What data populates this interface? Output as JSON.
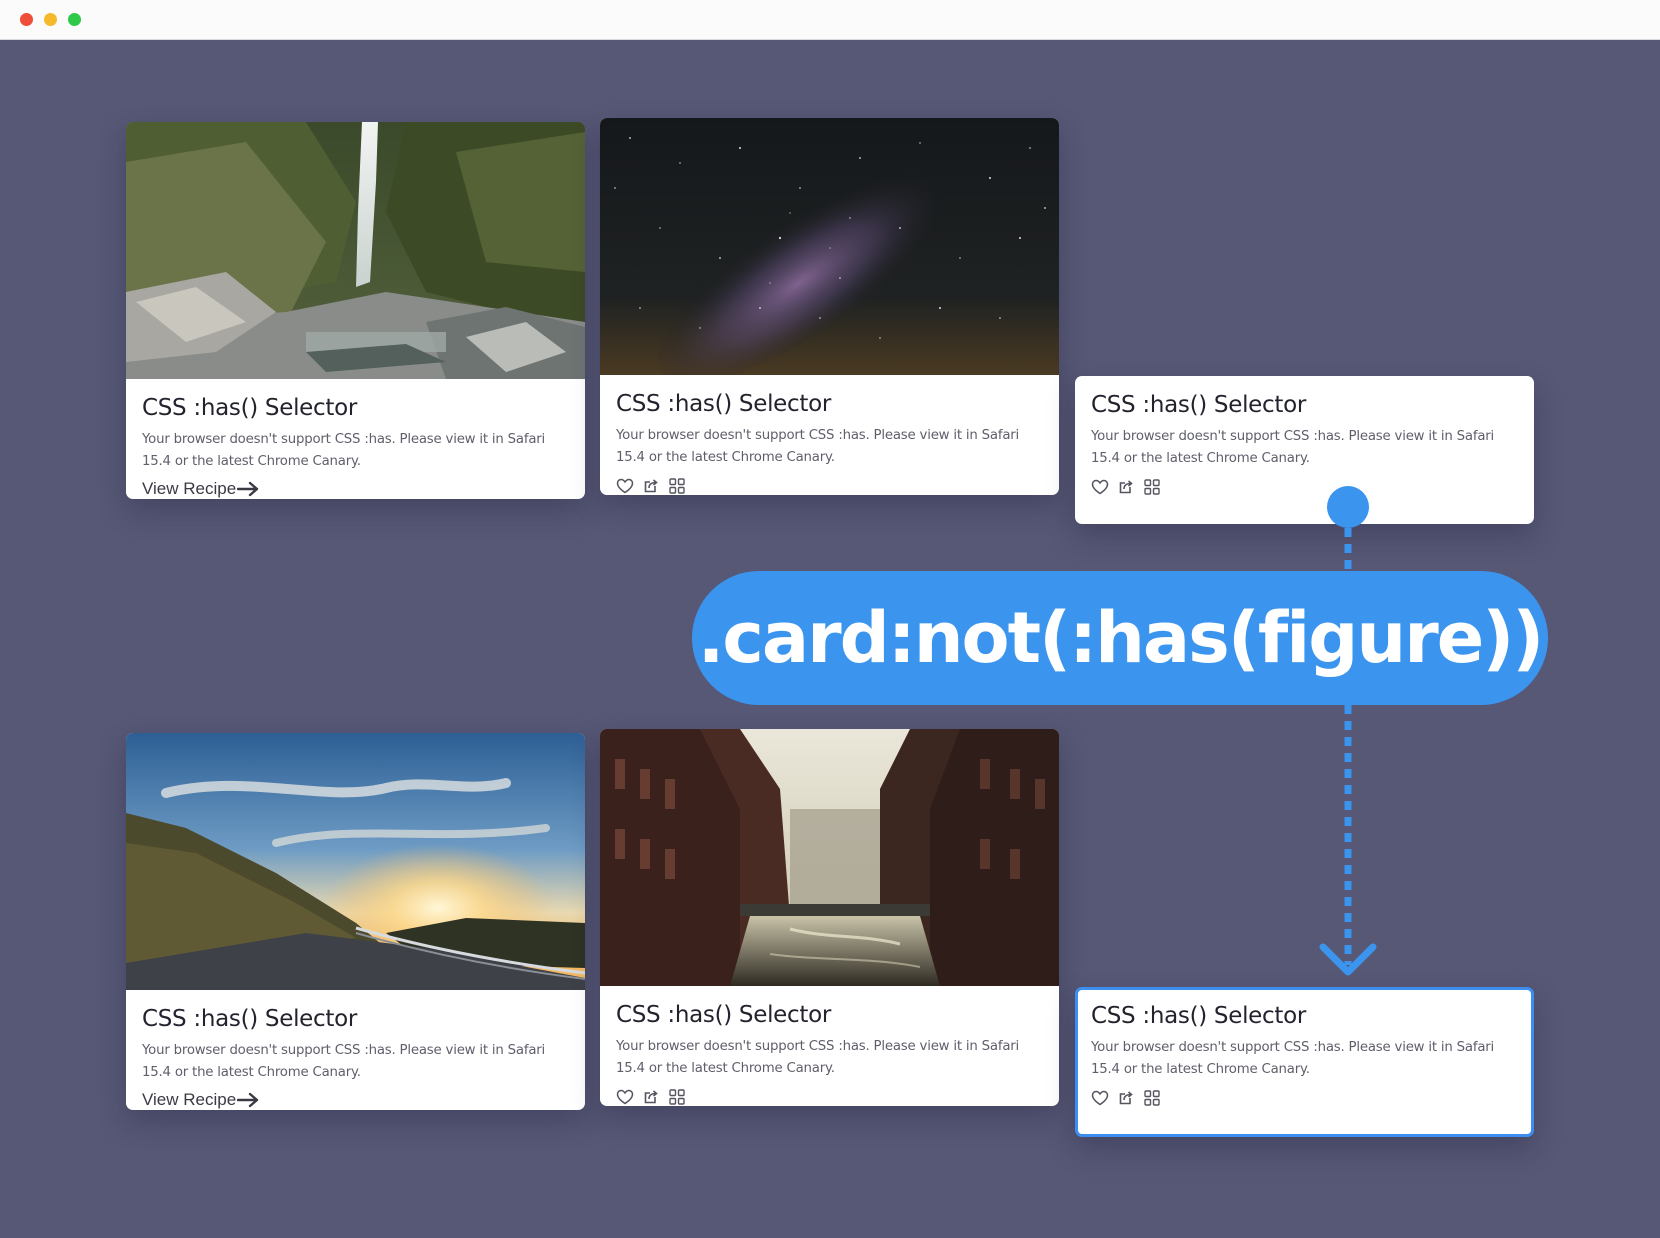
{
  "window": {
    "controls": [
      "close",
      "minimize",
      "zoom"
    ]
  },
  "cards": [
    {
      "id": "top-1",
      "title": "CSS :has() Selector",
      "description": "Your browser doesn't support CSS :has. Please view it in Safari 15.4 or the latest Chrome Canary.",
      "action": "View Recipe",
      "figure": "waterfall"
    },
    {
      "id": "top-2",
      "title": "CSS :has() Selector",
      "description": "Your browser doesn't support CSS :has. Please view it in Safari 15.4 or the latest Chrome Canary.",
      "icons": [
        "heart-icon",
        "share-icon",
        "grid-icon"
      ],
      "figure": "milky-way"
    },
    {
      "id": "top-3",
      "title": "CSS :has() Selector",
      "description": "Your browser doesn't support CSS :has. Please view it in Safari 15.4 or the latest Chrome Canary.",
      "icons": [
        "heart-icon",
        "share-icon",
        "grid-icon"
      ]
    },
    {
      "id": "bottom-1",
      "title": "CSS :has() Selector",
      "description": "Your browser doesn't support CSS :has. Please view it in Safari 15.4 or the latest Chrome Canary.",
      "action": "View Recipe",
      "figure": "sunset-road"
    },
    {
      "id": "bottom-2",
      "title": "CSS :has() Selector",
      "description": "Your browser doesn't support CSS :has. Please view it in Safari 15.4 or the latest Chrome Canary.",
      "icons": [
        "heart-icon",
        "share-icon",
        "grid-icon"
      ],
      "figure": "canal-city"
    },
    {
      "id": "bottom-3",
      "title": "CSS :has() Selector",
      "description": "Your browser doesn't support CSS :has. Please view it in Safari 15.4 or the latest Chrome Canary.",
      "icons": [
        "heart-icon",
        "share-icon",
        "grid-icon"
      ],
      "highlighted": true
    }
  ],
  "annotation": {
    "selector": ".card:not(:has(figure))"
  },
  "colors": {
    "background": "#575876",
    "accent": "#3b95ef",
    "card": "#ffffff",
    "title_text": "#23232e",
    "body_text": "#5f5f6c"
  }
}
